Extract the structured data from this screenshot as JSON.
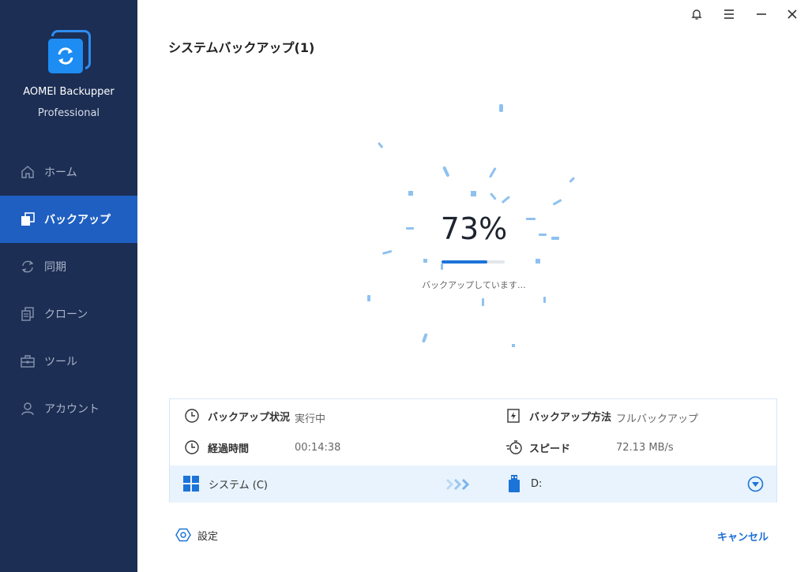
{
  "app": {
    "name": "AOMEI Backupper",
    "edition": "Professional"
  },
  "sidebar": {
    "items": [
      {
        "label": "ホーム",
        "icon": "home-icon",
        "active": false
      },
      {
        "label": "バックアップ",
        "icon": "backup-icon",
        "active": true
      },
      {
        "label": "同期",
        "icon": "sync-icon",
        "active": false
      },
      {
        "label": "クローン",
        "icon": "clone-icon",
        "active": false
      },
      {
        "label": "ツール",
        "icon": "toolbox-icon",
        "active": false
      },
      {
        "label": "アカウント",
        "icon": "user-icon",
        "active": false
      }
    ]
  },
  "window_controls": [
    "bell-icon",
    "menu-icon",
    "minimize-icon",
    "close-icon"
  ],
  "page": {
    "title": "システムバックアップ(1)"
  },
  "progress": {
    "percent_text": "73%",
    "value": 0.73,
    "status": "バックアップしています…"
  },
  "info": {
    "status_label": "バックアップ状況",
    "status_value": "実行中",
    "method_label": "バックアップ方法",
    "method_value": "フルバックアップ",
    "elapsed_label": "経過時間",
    "elapsed_value": "00:14:38",
    "speed_label": "スピード",
    "speed_value": "72.13 MB/s"
  },
  "route": {
    "source": "システム (C)",
    "destination": "D:"
  },
  "footer": {
    "settings": "設定",
    "cancel": "キャンセル"
  },
  "colors": {
    "sidebar_bg": "#1c2e54",
    "active_bg": "#1f5fc1",
    "accent": "#1c74d8",
    "route_bg": "#e8f3fd"
  }
}
